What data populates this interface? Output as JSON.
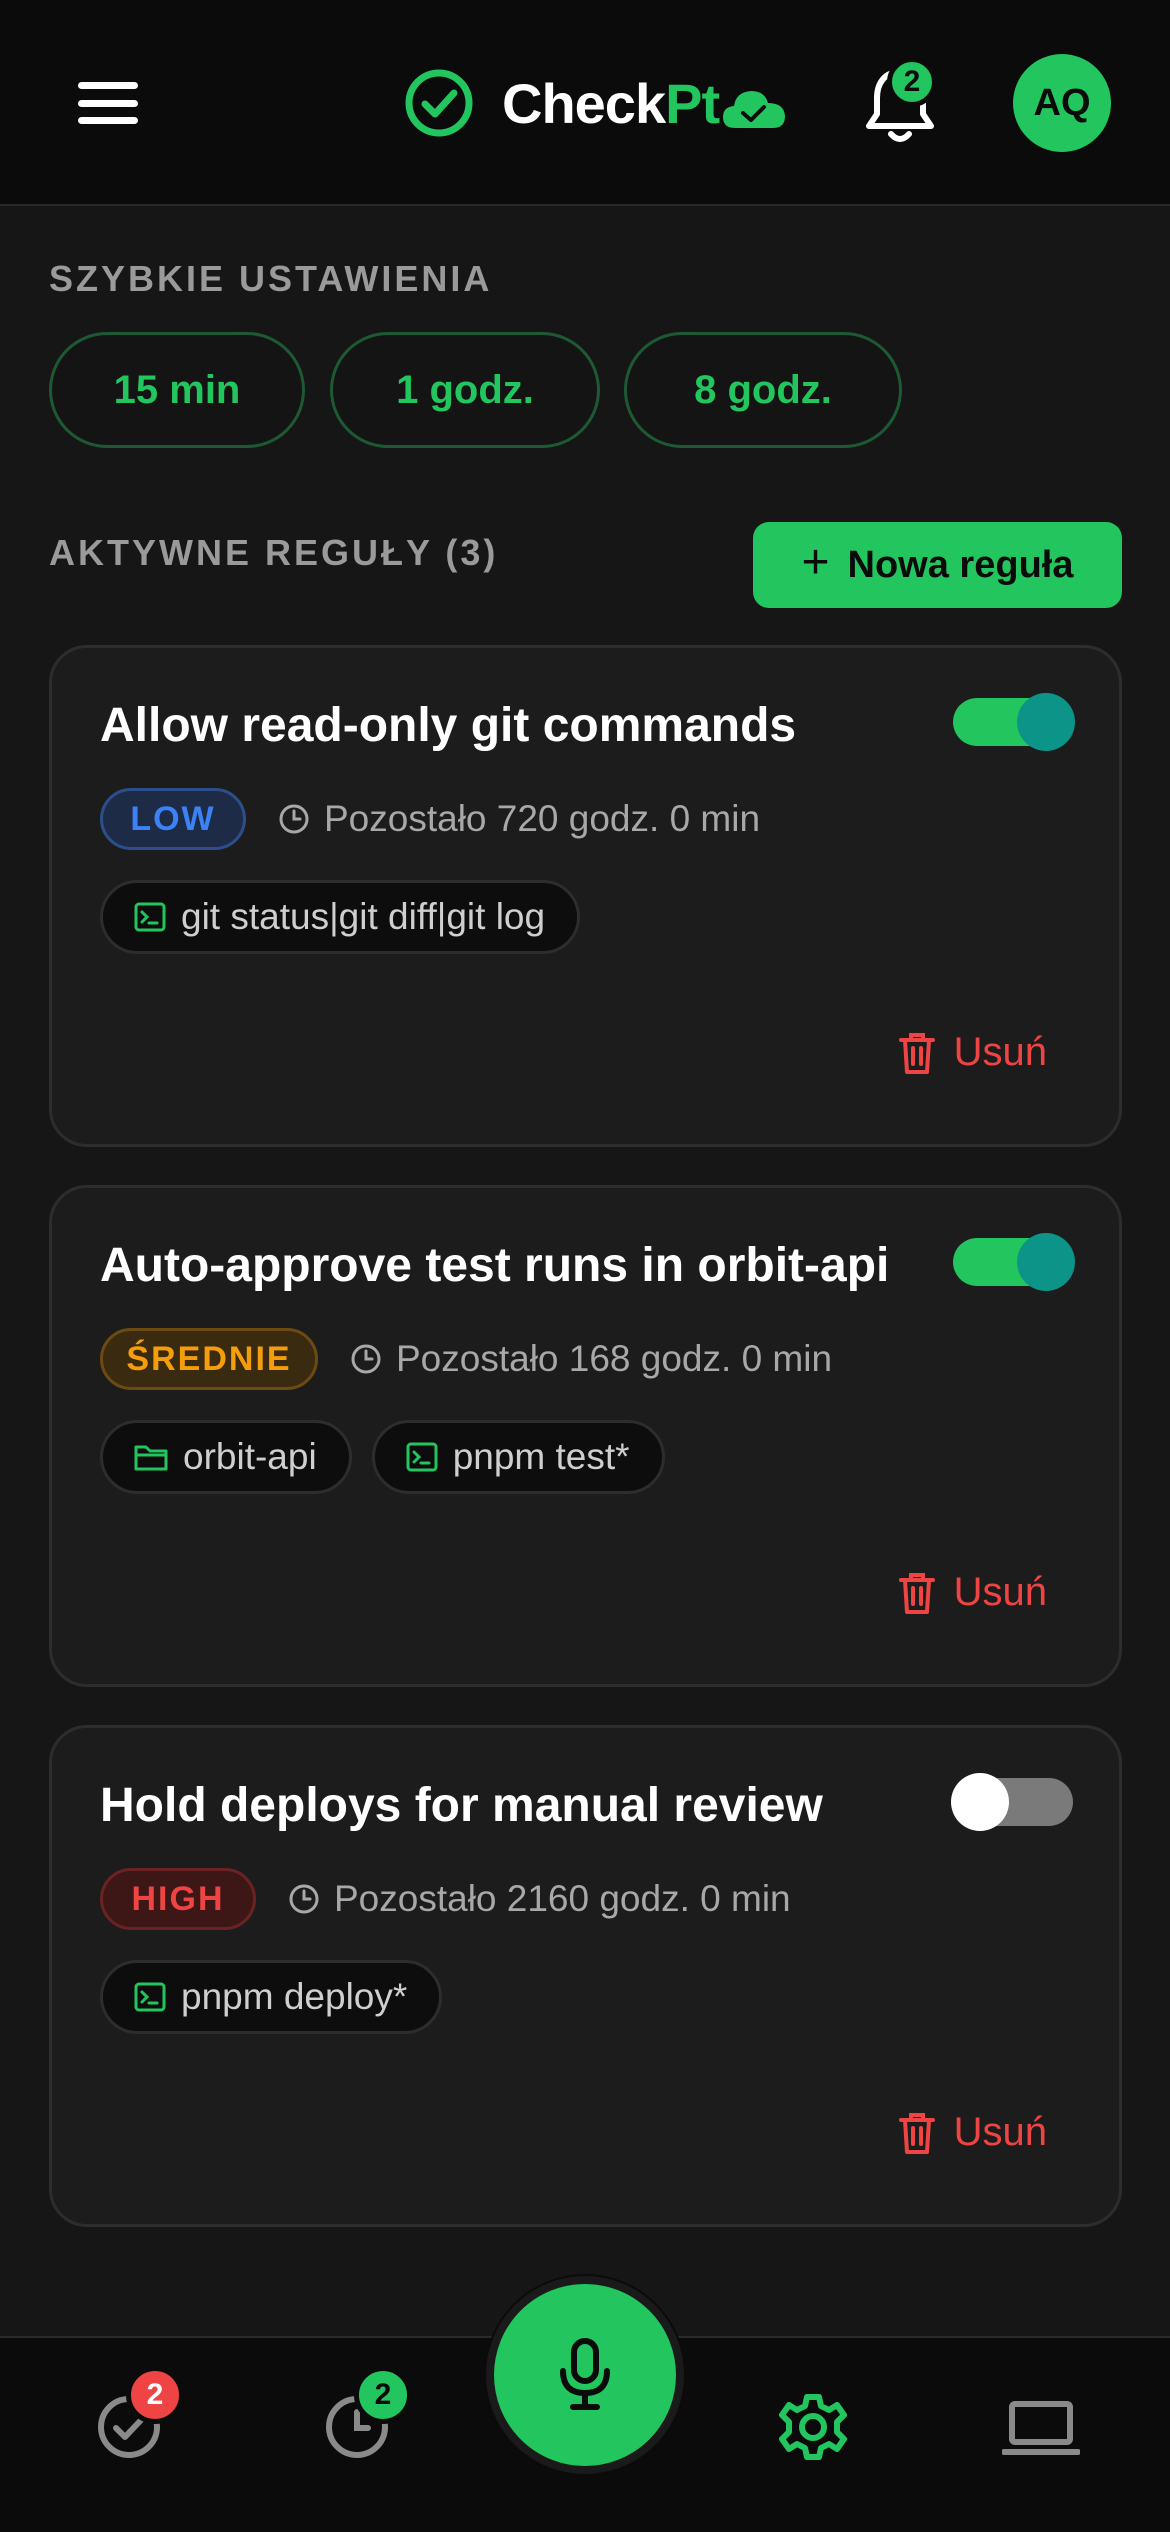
{
  "app": {
    "logo_text_a": "Check",
    "logo_text_b": "Pt",
    "notification_count": "2",
    "avatar_initials": "AQ"
  },
  "quick_settings": {
    "label": "SZYBKIE USTAWIENIA",
    "presets": [
      "15 min",
      "1 godz.",
      "8 godz."
    ]
  },
  "rules_section": {
    "label": "AKTYWNE REGUŁY (3)",
    "new_rule_label": "Nowa reguła"
  },
  "rules": [
    {
      "title": "Allow read-only git commands",
      "enabled": true,
      "risk": "LOW",
      "remaining": "Pozostało 720 godz. 0 min",
      "chips": [
        {
          "icon": "terminal-icon",
          "text": "git status|git diff|git log"
        }
      ],
      "delete_label": "Usuń"
    },
    {
      "title": "Auto-approve test runs in orbit-api",
      "enabled": true,
      "risk": "ŚREDNIE",
      "remaining": "Pozostało 168 godz. 0 min",
      "chips": [
        {
          "icon": "folder-icon",
          "text": "orbit-api"
        },
        {
          "icon": "terminal-icon",
          "text": "pnpm test*"
        }
      ],
      "delete_label": "Usuń"
    },
    {
      "title": "Hold deploys for manual review",
      "enabled": false,
      "risk": "HIGH",
      "remaining": "Pozostało 2160 godz. 0 min",
      "chips": [
        {
          "icon": "terminal-icon",
          "text": "pnpm deploy*"
        }
      ],
      "delete_label": "Usuń"
    }
  ],
  "bottom_nav": {
    "approvals_count": "2",
    "history_count": "2"
  },
  "colors": {
    "accent": "#22c55e",
    "danger": "#ef4444",
    "warning": "#f59e0b",
    "info": "#3b82f6",
    "background": "#161616"
  }
}
